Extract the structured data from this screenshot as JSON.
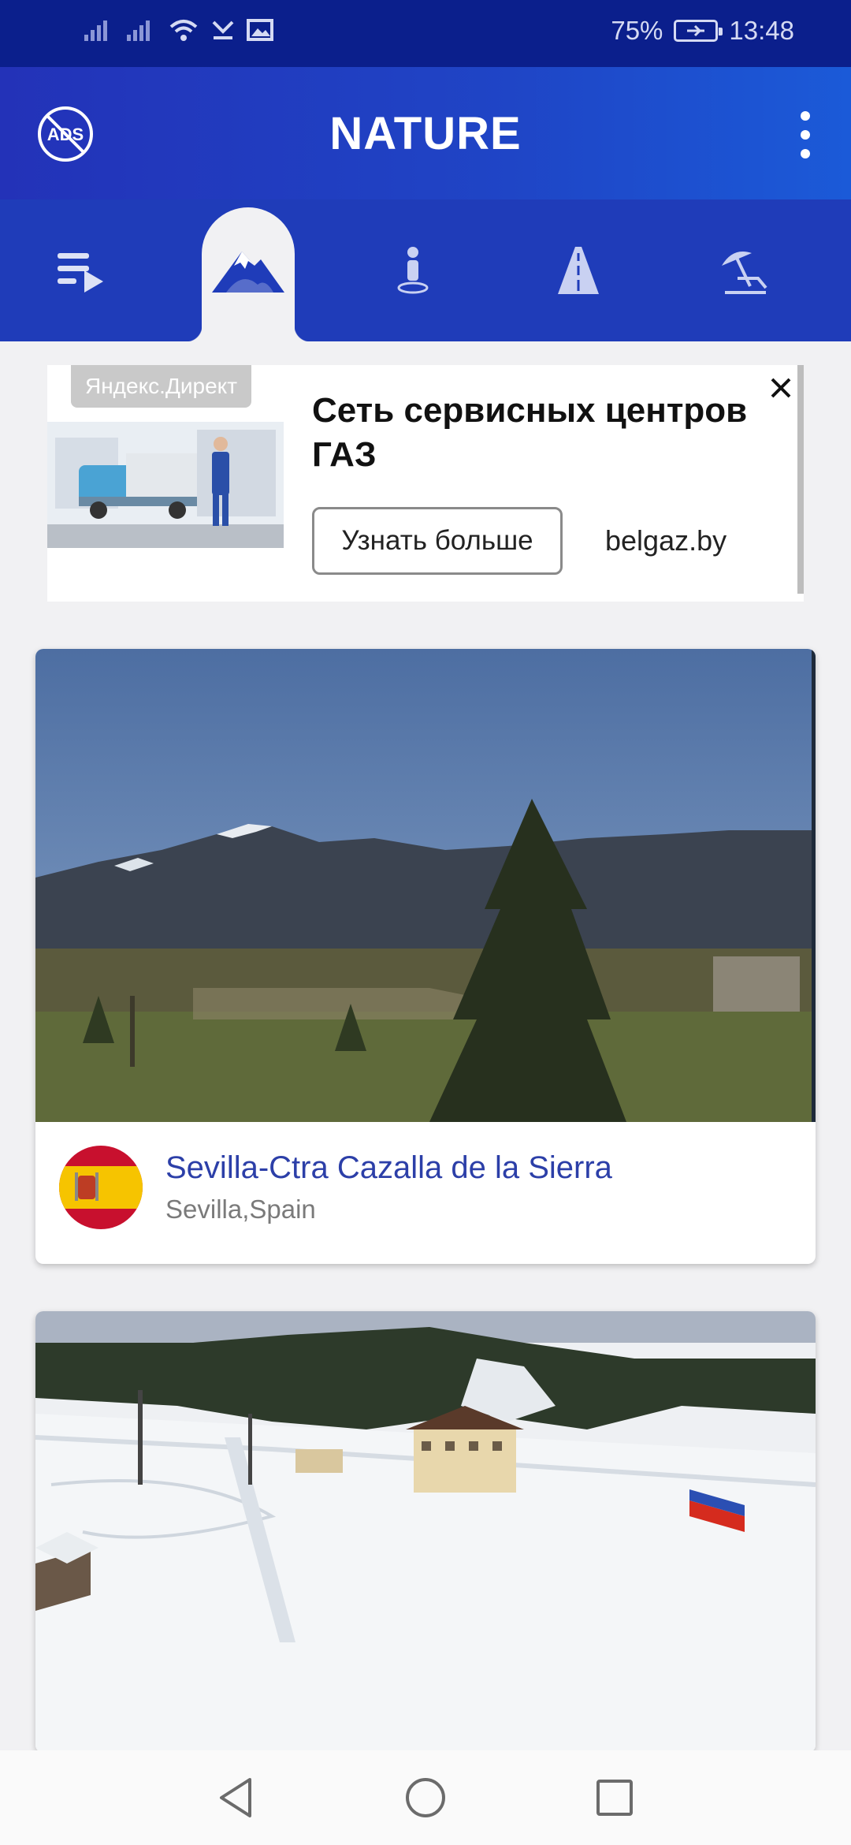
{
  "status_bar": {
    "battery": "75%",
    "time": "13:48"
  },
  "app_bar": {
    "title": "NATURE",
    "ads_icon_text": "ADS"
  },
  "tabs": [
    {
      "icon": "playlist-icon",
      "active": false
    },
    {
      "icon": "mountain-icon",
      "active": true
    },
    {
      "icon": "person-pin-icon",
      "active": false
    },
    {
      "icon": "road-icon",
      "active": false
    },
    {
      "icon": "beach-umbrella-icon",
      "active": false
    }
  ],
  "ad": {
    "badge": "Яндекс.Директ",
    "title": "Сеть сервисных центров ГАЗ",
    "button": "Узнать больше",
    "domain": "belgaz.by"
  },
  "cards": [
    {
      "title": "Sevilla-Ctra Cazalla de la Sierra",
      "location": "Sevilla,Spain",
      "flag": "spain-flag"
    },
    {
      "title": "",
      "location": ""
    }
  ],
  "colors": {
    "status_bar": "#0b1f8c",
    "app_bar": "#2332b8",
    "tab_bar": "#1f3cb9",
    "accent_text": "#2c3fa8",
    "background": "#f1f1f3"
  }
}
